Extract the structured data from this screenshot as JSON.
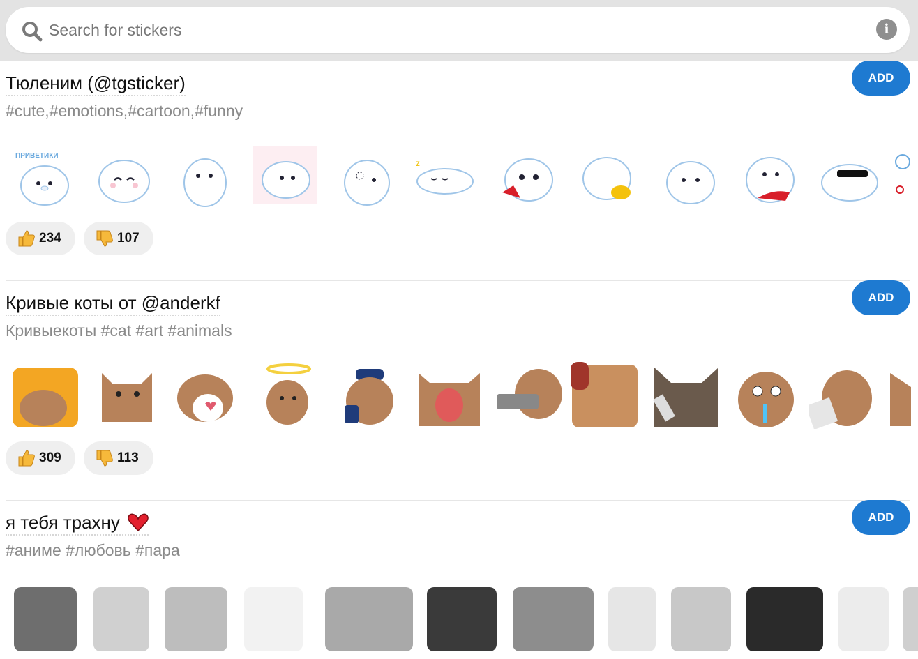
{
  "search": {
    "placeholder": "Search for stickers",
    "icon": "search-icon",
    "info_icon": "info-icon"
  },
  "packs": [
    {
      "title": "Тюленим (@tgsticker)",
      "tags": "#cute,#emotions,#cartoon,#funny",
      "add_label": "ADD",
      "likes": "234",
      "dislikes": "107",
      "sticker_art": "white seal",
      "sticker_caption": "ПРИВЕТИКИ"
    },
    {
      "title": "Кривые коты от @anderkf",
      "tags": "Кривыекоты #cat #art  #animals",
      "add_label": "ADD",
      "likes": "309",
      "dislikes": "113",
      "sticker_art": "brown cat"
    },
    {
      "title": "я тебя трахну",
      "title_emoji": "heart-icon",
      "tags": " #аниме  #любовь  #пара",
      "add_label": "ADD",
      "sticker_art": "manga panel"
    }
  ],
  "colors": {
    "accent": "#1e7ad1",
    "vote_bg": "#efefef",
    "tag": "#8a8a8a"
  }
}
